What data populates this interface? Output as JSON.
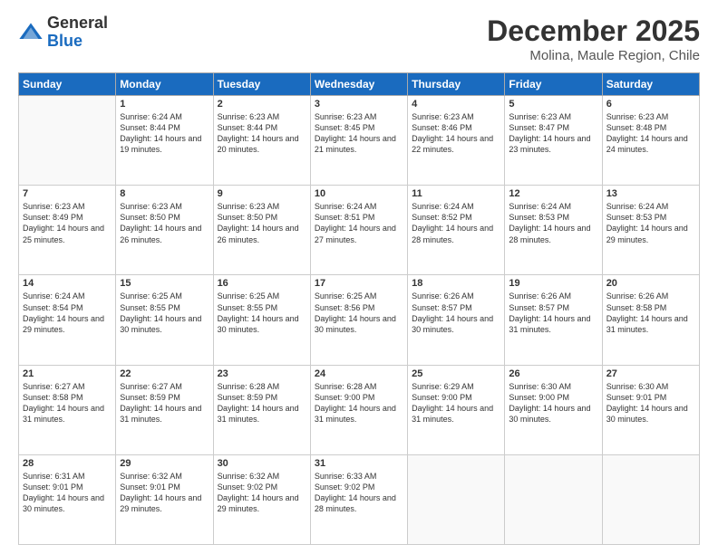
{
  "logo": {
    "general": "General",
    "blue": "Blue"
  },
  "header": {
    "month": "December 2025",
    "location": "Molina, Maule Region, Chile"
  },
  "weekdays": [
    "Sunday",
    "Monday",
    "Tuesday",
    "Wednesday",
    "Thursday",
    "Friday",
    "Saturday"
  ],
  "weeks": [
    [
      {
        "day": null,
        "sunrise": null,
        "sunset": null,
        "daylight": null
      },
      {
        "day": "1",
        "sunrise": "Sunrise: 6:24 AM",
        "sunset": "Sunset: 8:44 PM",
        "daylight": "Daylight: 14 hours and 19 minutes."
      },
      {
        "day": "2",
        "sunrise": "Sunrise: 6:23 AM",
        "sunset": "Sunset: 8:44 PM",
        "daylight": "Daylight: 14 hours and 20 minutes."
      },
      {
        "day": "3",
        "sunrise": "Sunrise: 6:23 AM",
        "sunset": "Sunset: 8:45 PM",
        "daylight": "Daylight: 14 hours and 21 minutes."
      },
      {
        "day": "4",
        "sunrise": "Sunrise: 6:23 AM",
        "sunset": "Sunset: 8:46 PM",
        "daylight": "Daylight: 14 hours and 22 minutes."
      },
      {
        "day": "5",
        "sunrise": "Sunrise: 6:23 AM",
        "sunset": "Sunset: 8:47 PM",
        "daylight": "Daylight: 14 hours and 23 minutes."
      },
      {
        "day": "6",
        "sunrise": "Sunrise: 6:23 AM",
        "sunset": "Sunset: 8:48 PM",
        "daylight": "Daylight: 14 hours and 24 minutes."
      }
    ],
    [
      {
        "day": "7",
        "sunrise": "Sunrise: 6:23 AM",
        "sunset": "Sunset: 8:49 PM",
        "daylight": "Daylight: 14 hours and 25 minutes."
      },
      {
        "day": "8",
        "sunrise": "Sunrise: 6:23 AM",
        "sunset": "Sunset: 8:50 PM",
        "daylight": "Daylight: 14 hours and 26 minutes."
      },
      {
        "day": "9",
        "sunrise": "Sunrise: 6:23 AM",
        "sunset": "Sunset: 8:50 PM",
        "daylight": "Daylight: 14 hours and 26 minutes."
      },
      {
        "day": "10",
        "sunrise": "Sunrise: 6:24 AM",
        "sunset": "Sunset: 8:51 PM",
        "daylight": "Daylight: 14 hours and 27 minutes."
      },
      {
        "day": "11",
        "sunrise": "Sunrise: 6:24 AM",
        "sunset": "Sunset: 8:52 PM",
        "daylight": "Daylight: 14 hours and 28 minutes."
      },
      {
        "day": "12",
        "sunrise": "Sunrise: 6:24 AM",
        "sunset": "Sunset: 8:53 PM",
        "daylight": "Daylight: 14 hours and 28 minutes."
      },
      {
        "day": "13",
        "sunrise": "Sunrise: 6:24 AM",
        "sunset": "Sunset: 8:53 PM",
        "daylight": "Daylight: 14 hours and 29 minutes."
      }
    ],
    [
      {
        "day": "14",
        "sunrise": "Sunrise: 6:24 AM",
        "sunset": "Sunset: 8:54 PM",
        "daylight": "Daylight: 14 hours and 29 minutes."
      },
      {
        "day": "15",
        "sunrise": "Sunrise: 6:25 AM",
        "sunset": "Sunset: 8:55 PM",
        "daylight": "Daylight: 14 hours and 30 minutes."
      },
      {
        "day": "16",
        "sunrise": "Sunrise: 6:25 AM",
        "sunset": "Sunset: 8:55 PM",
        "daylight": "Daylight: 14 hours and 30 minutes."
      },
      {
        "day": "17",
        "sunrise": "Sunrise: 6:25 AM",
        "sunset": "Sunset: 8:56 PM",
        "daylight": "Daylight: 14 hours and 30 minutes."
      },
      {
        "day": "18",
        "sunrise": "Sunrise: 6:26 AM",
        "sunset": "Sunset: 8:57 PM",
        "daylight": "Daylight: 14 hours and 30 minutes."
      },
      {
        "day": "19",
        "sunrise": "Sunrise: 6:26 AM",
        "sunset": "Sunset: 8:57 PM",
        "daylight": "Daylight: 14 hours and 31 minutes."
      },
      {
        "day": "20",
        "sunrise": "Sunrise: 6:26 AM",
        "sunset": "Sunset: 8:58 PM",
        "daylight": "Daylight: 14 hours and 31 minutes."
      }
    ],
    [
      {
        "day": "21",
        "sunrise": "Sunrise: 6:27 AM",
        "sunset": "Sunset: 8:58 PM",
        "daylight": "Daylight: 14 hours and 31 minutes."
      },
      {
        "day": "22",
        "sunrise": "Sunrise: 6:27 AM",
        "sunset": "Sunset: 8:59 PM",
        "daylight": "Daylight: 14 hours and 31 minutes."
      },
      {
        "day": "23",
        "sunrise": "Sunrise: 6:28 AM",
        "sunset": "Sunset: 8:59 PM",
        "daylight": "Daylight: 14 hours and 31 minutes."
      },
      {
        "day": "24",
        "sunrise": "Sunrise: 6:28 AM",
        "sunset": "Sunset: 9:00 PM",
        "daylight": "Daylight: 14 hours and 31 minutes."
      },
      {
        "day": "25",
        "sunrise": "Sunrise: 6:29 AM",
        "sunset": "Sunset: 9:00 PM",
        "daylight": "Daylight: 14 hours and 31 minutes."
      },
      {
        "day": "26",
        "sunrise": "Sunrise: 6:30 AM",
        "sunset": "Sunset: 9:00 PM",
        "daylight": "Daylight: 14 hours and 30 minutes."
      },
      {
        "day": "27",
        "sunrise": "Sunrise: 6:30 AM",
        "sunset": "Sunset: 9:01 PM",
        "daylight": "Daylight: 14 hours and 30 minutes."
      }
    ],
    [
      {
        "day": "28",
        "sunrise": "Sunrise: 6:31 AM",
        "sunset": "Sunset: 9:01 PM",
        "daylight": "Daylight: 14 hours and 30 minutes."
      },
      {
        "day": "29",
        "sunrise": "Sunrise: 6:32 AM",
        "sunset": "Sunset: 9:01 PM",
        "daylight": "Daylight: 14 hours and 29 minutes."
      },
      {
        "day": "30",
        "sunrise": "Sunrise: 6:32 AM",
        "sunset": "Sunset: 9:02 PM",
        "daylight": "Daylight: 14 hours and 29 minutes."
      },
      {
        "day": "31",
        "sunrise": "Sunrise: 6:33 AM",
        "sunset": "Sunset: 9:02 PM",
        "daylight": "Daylight: 14 hours and 28 minutes."
      },
      {
        "day": null,
        "sunrise": null,
        "sunset": null,
        "daylight": null
      },
      {
        "day": null,
        "sunrise": null,
        "sunset": null,
        "daylight": null
      },
      {
        "day": null,
        "sunrise": null,
        "sunset": null,
        "daylight": null
      }
    ]
  ]
}
